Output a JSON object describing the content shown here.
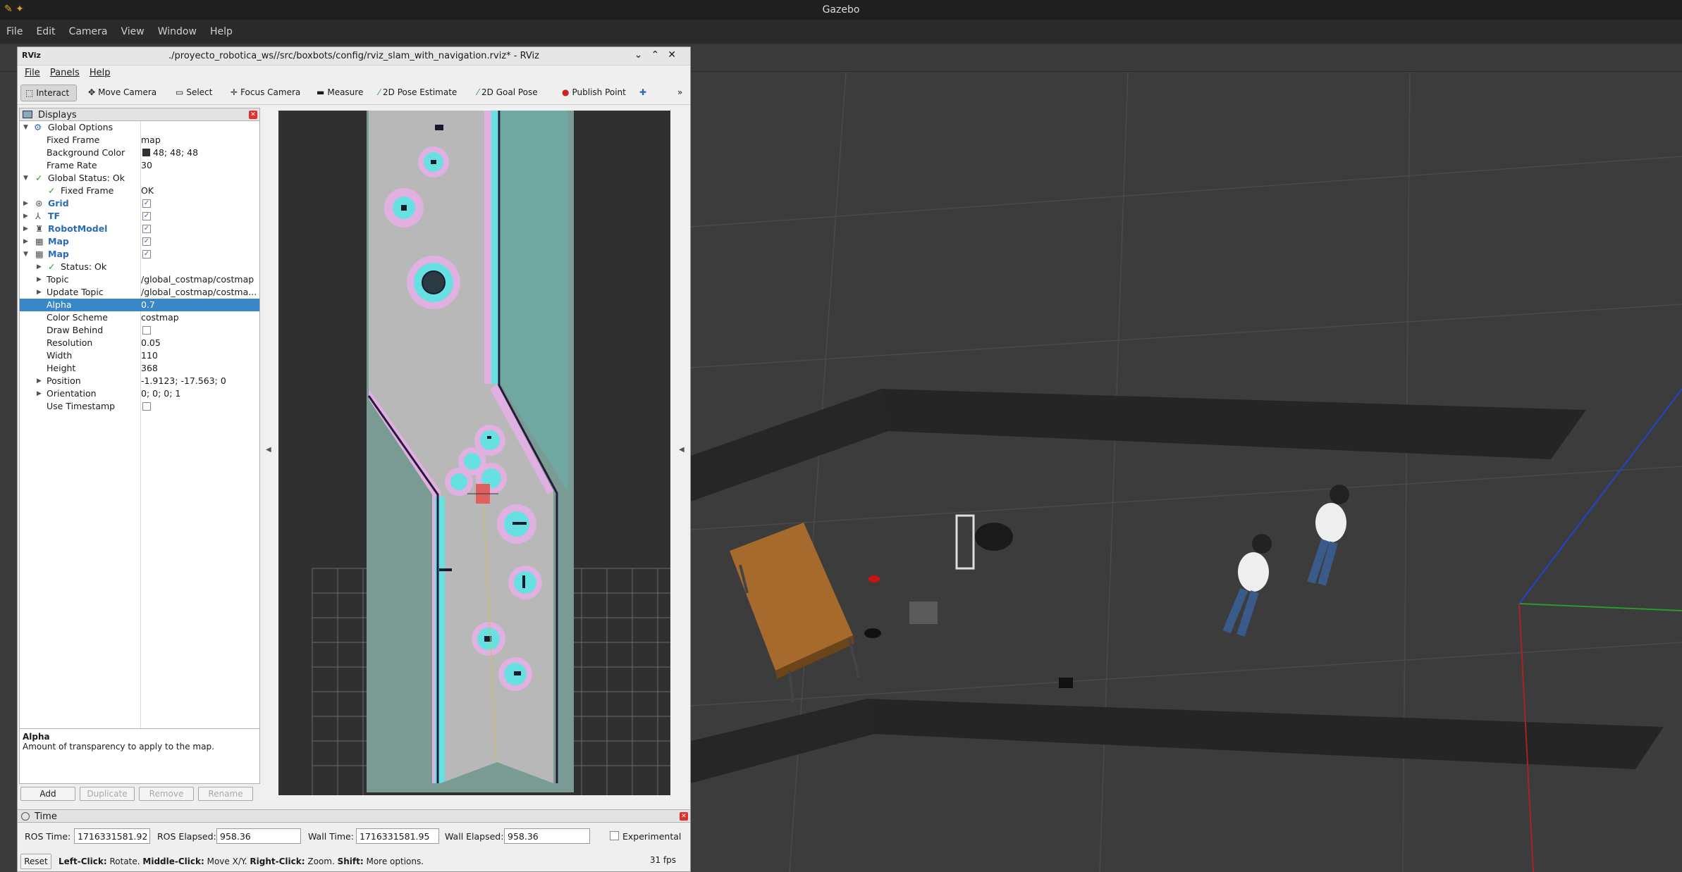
{
  "gazebo": {
    "title": "Gazebo",
    "menu": [
      "File",
      "Edit",
      "Camera",
      "View",
      "Window",
      "Help"
    ]
  },
  "rviz": {
    "logo": "RViz",
    "title": "./proyecto_robotica_ws//src/boxbots/config/rviz_slam_with_navigation.rviz* - RViz",
    "menu": [
      "File",
      "Panels",
      "Help"
    ],
    "tools": [
      "Interact",
      "Move Camera",
      "Select",
      "Focus Camera",
      "Measure",
      "2D Pose Estimate",
      "2D Goal Pose",
      "Publish Point"
    ],
    "more": "»",
    "displays": {
      "title": "Displays",
      "rows": [
        {
          "name": "Global Options",
          "value": ""
        },
        {
          "name": "Fixed Frame",
          "value": "map"
        },
        {
          "name": "Background Color",
          "value": "48; 48; 48"
        },
        {
          "name": "Frame Rate",
          "value": "30"
        },
        {
          "name": "Global Status: Ok",
          "value": ""
        },
        {
          "name": "Fixed Frame",
          "value": "OK"
        },
        {
          "name": "Grid",
          "value": ""
        },
        {
          "name": "TF",
          "value": ""
        },
        {
          "name": "RobotModel",
          "value": ""
        },
        {
          "name": "Map",
          "value": ""
        },
        {
          "name": "Map",
          "value": ""
        },
        {
          "name": "Status: Ok",
          "value": ""
        },
        {
          "name": "Topic",
          "value": "/global_costmap/costmap"
        },
        {
          "name": "Update Topic",
          "value": "/global_costmap/costma..."
        },
        {
          "name": "Alpha",
          "value": "0.7"
        },
        {
          "name": "Color Scheme",
          "value": "costmap"
        },
        {
          "name": "Draw Behind",
          "value": ""
        },
        {
          "name": "Resolution",
          "value": "0.05"
        },
        {
          "name": "Width",
          "value": "110"
        },
        {
          "name": "Height",
          "value": "368"
        },
        {
          "name": "Position",
          "value": "-1.9123; -17.563; 0"
        },
        {
          "name": "Orientation",
          "value": "0; 0; 0; 1"
        },
        {
          "name": "Use Timestamp",
          "value": ""
        }
      ],
      "description_title": "Alpha",
      "description_text": "Amount of transparency to apply to the map.",
      "buttons": [
        "Add",
        "Duplicate",
        "Remove",
        "Rename"
      ]
    },
    "time": {
      "title": "Time",
      "ros_time_label": "ROS Time:",
      "ros_time": "1716331581.92",
      "ros_elapsed_label": "ROS Elapsed:",
      "ros_elapsed": "958.36",
      "wall_time_label": "Wall Time:",
      "wall_time": "1716331581.95",
      "wall_elapsed_label": "Wall Elapsed:",
      "wall_elapsed": "958.36",
      "experimental_label": "Experimental",
      "reset_label": "Reset",
      "hint_parts": [
        "Left-Click:",
        " Rotate. ",
        "Middle-Click:",
        " Move X/Y. ",
        "Right-Click:",
        " Zoom. ",
        "Shift:",
        " More options."
      ],
      "fps": "31 fps"
    }
  },
  "colors": {
    "rviz_bg": "#303030",
    "costmap_free": "#b8b8b8",
    "costmap_inflation": "#66e0e0",
    "costmap_halo": "#e0b0e0",
    "costmap_unknown": "#7a9a94",
    "selection": "#3a87c8"
  }
}
